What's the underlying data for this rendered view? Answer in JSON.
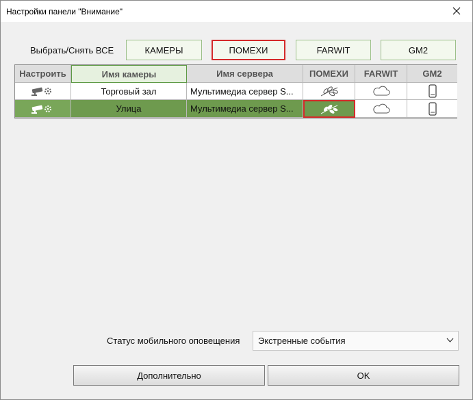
{
  "window": {
    "title": "Настройки панели \"Внимание\"",
    "close_glyph": "✕"
  },
  "selector": {
    "label": "Выбрать/Снять ВСЕ",
    "buttons": [
      {
        "label": "КАМЕРЫ",
        "active": false
      },
      {
        "label": "ПОМЕХИ",
        "active": true
      },
      {
        "label": "FARWIT",
        "active": false
      },
      {
        "label": "GM2",
        "active": false
      }
    ]
  },
  "table": {
    "headers": [
      "Настроить",
      "Имя камеры",
      "Имя сервера",
      "ПОМЕХИ",
      "FARWIT",
      "GM2"
    ],
    "rows": [
      {
        "camera_name": "Торговый зал",
        "server_name": "Мультимедиа сервер S...",
        "selected": false
      },
      {
        "camera_name": "Улица",
        "server_name": "Мультимедиа сервер S...",
        "selected": true
      }
    ],
    "icons": {
      "settings": "camera-settings-icon",
      "noise": "leaves-icon",
      "farwit": "cloud-icon",
      "gm2": "mobile-phone-icon"
    }
  },
  "mobile_status": {
    "label": "Статус мобильного оповещения",
    "value": "Экстренные события"
  },
  "buttons": {
    "more": "Дополнительно",
    "ok": "OK"
  },
  "colors": {
    "selected_row": "#6e9a4e",
    "highlight_red": "#d42a2a",
    "accent_green": "#9cbf8a"
  }
}
